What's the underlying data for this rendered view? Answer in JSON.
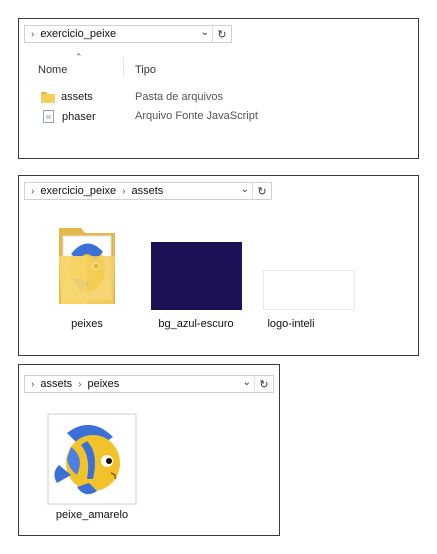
{
  "window1": {
    "path": [
      "exercicio_peixe"
    ],
    "columns": {
      "name": "Nome",
      "type": "Tipo"
    },
    "rows": [
      {
        "name": "assets",
        "type": "Pasta de arquivos",
        "icon": "folder-icon"
      },
      {
        "name": "phaser",
        "type": "Arquivo Fonte JavaScript",
        "icon": "js-file-icon"
      }
    ]
  },
  "window2": {
    "path": [
      "exercicio_peixe",
      "assets"
    ],
    "items": [
      {
        "label": "peixes",
        "icon": "folder-with-fish-preview-icon"
      },
      {
        "label": "bg_azul-escuro",
        "icon": "dark-blue-image-thumbnail"
      },
      {
        "label": "logo-inteli",
        "icon": "blank-image-thumbnail"
      }
    ]
  },
  "window3": {
    "path": [
      "assets",
      "peixes"
    ],
    "items": [
      {
        "label": "peixe_amarelo",
        "icon": "yellow-fish-image-thumbnail"
      }
    ]
  },
  "colors": {
    "folder": "#f5cf5c",
    "bg_thumb": "#1e1257",
    "fish_yellow": "#f2c22a",
    "fish_blue": "#3d6fd8"
  }
}
